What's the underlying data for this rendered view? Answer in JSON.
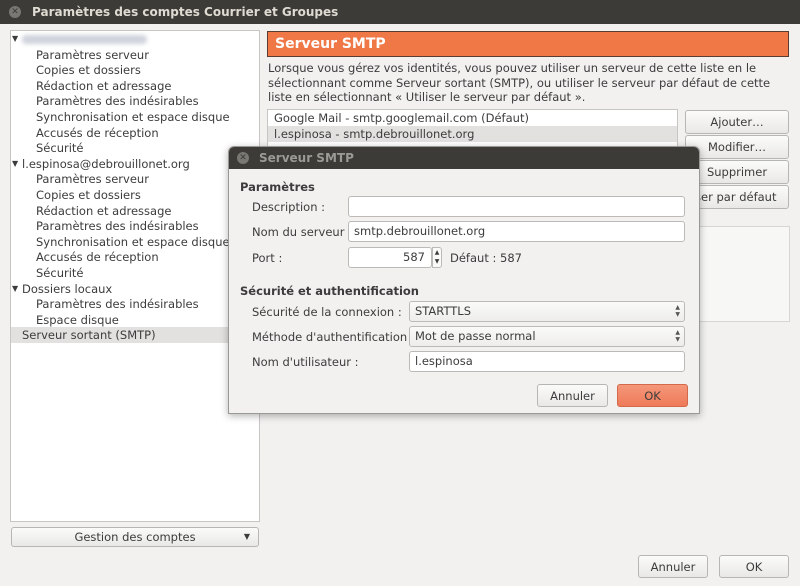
{
  "window": {
    "title": "Paramètres des comptes Courrier et Groupes"
  },
  "tree": {
    "accounts": [
      {
        "label": "",
        "blurred": true,
        "items": [
          "Paramètres serveur",
          "Copies et dossiers",
          "Rédaction et adressage",
          "Paramètres des indésirables",
          "Synchronisation et espace disque",
          "Accusés de réception",
          "Sécurité"
        ]
      },
      {
        "label": "l.espinosa@debrouillonet.org",
        "items": [
          "Paramètres serveur",
          "Copies et dossiers",
          "Rédaction et adressage",
          "Paramètres des indésirables",
          "Synchronisation et espace disque",
          "Accusés de réception",
          "Sécurité"
        ]
      },
      {
        "label": "Dossiers locaux",
        "items": [
          "Paramètres des indésirables",
          "Espace disque"
        ]
      }
    ],
    "smtp_item": "Serveur sortant (SMTP)",
    "manage_button": "Gestion des comptes"
  },
  "main": {
    "header": "Serveur SMTP",
    "description": "Lorsque vous gérez vos identités, vous pouvez utiliser un serveur de cette liste en le sélectionnant comme Serveur sortant (SMTP), ou utiliser le serveur par défaut de cette liste en sélectionnant « Utiliser le serveur par défaut ».",
    "servers": [
      "Google Mail - smtp.googlemail.com (Défaut)",
      "l.espinosa - smtp.debrouillonet.org"
    ],
    "buttons": {
      "add": "Ajouter…",
      "edit": "Modifier…",
      "remove": "Supprimer",
      "default": "Utiliser par défaut"
    }
  },
  "dialog": {
    "title": "Serveur SMTP",
    "section_params": "Paramètres",
    "description_label": "Description :",
    "description_value": "",
    "server_label": "Nom du serveur :",
    "server_value": "smtp.debrouillonet.org",
    "port_label": "Port :",
    "port_value": "587",
    "default_label": "Défaut :",
    "default_value": "587",
    "section_security": "Sécurité et authentification",
    "conn_security_label": "Sécurité de la connexion :",
    "conn_security_value": "STARTTLS",
    "auth_label": "Méthode d'authentification :",
    "auth_value": "Mot de passe normal",
    "user_label": "Nom d'utilisateur :",
    "user_value": "l.espinosa",
    "cancel": "Annuler",
    "ok": "OK"
  },
  "footer": {
    "cancel": "Annuler",
    "ok": "OK"
  },
  "colors": {
    "accent": "#f07746",
    "titlebar": "#3c3b37"
  }
}
